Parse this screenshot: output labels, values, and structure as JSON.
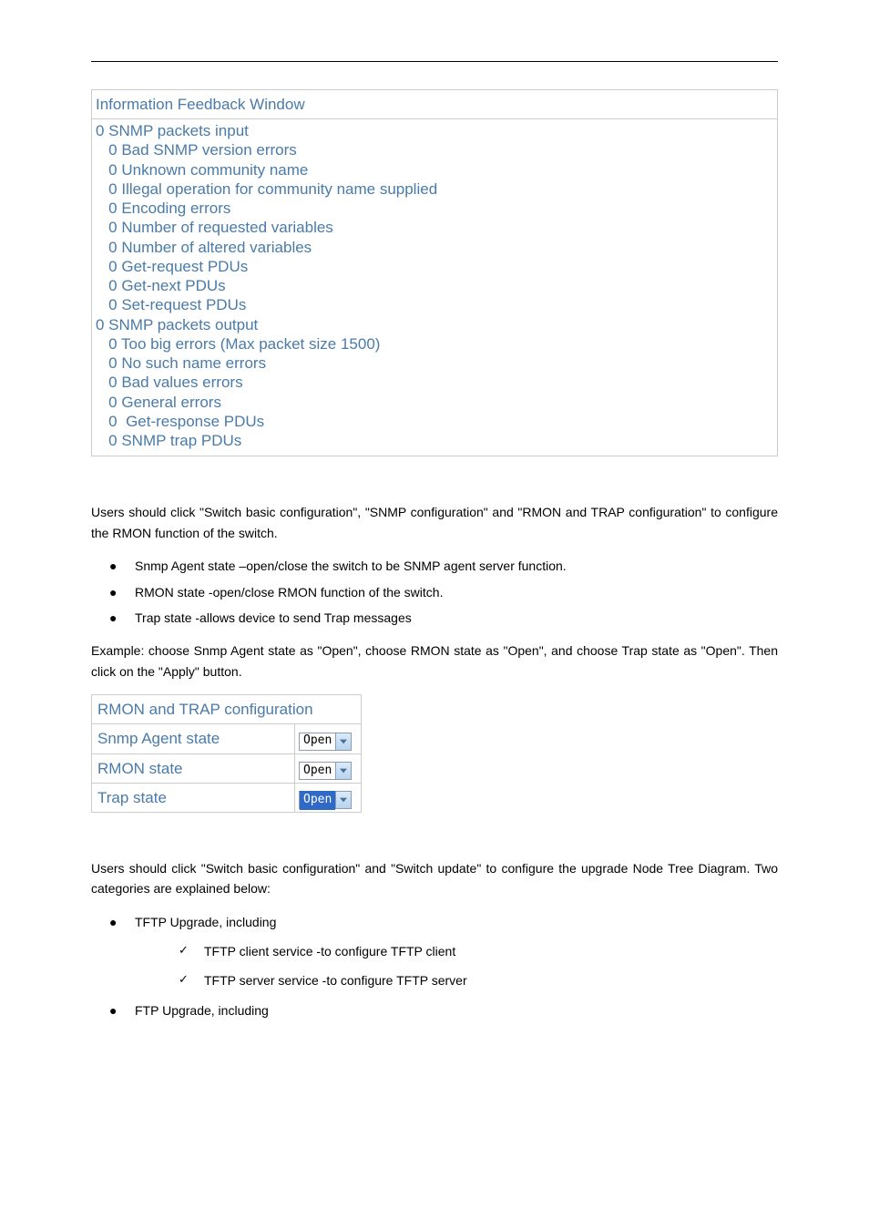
{
  "info_window": {
    "title": "Information Feedback Window",
    "lines": [
      "0 SNMP packets input",
      "   0 Bad SNMP version errors",
      "   0 Unknown community name",
      "   0 Illegal operation for community name supplied",
      "   0 Encoding errors",
      "   0 Number of requested variables",
      "   0 Number of altered variables",
      "   0 Get-request PDUs",
      "   0 Get-next PDUs",
      "   0 Set-request PDUs",
      "0 SNMP packets output",
      "   0 Too big errors (Max packet size 1500)",
      "   0 No such name errors",
      "   0 Bad values errors",
      "   0 General errors",
      "   0  Get-response PDUs",
      "   0 SNMP trap PDUs"
    ]
  },
  "paragraph1": "Users should click \"Switch basic configuration\", \"SNMP configuration\" and \"RMON and TRAP configuration\" to configure the RMON function of the switch.",
  "bullets1": [
    "Snmp Agent state –open/close the switch to be SNMP agent server function.",
    "RMON state -open/close RMON function of the switch.",
    "Trap state -allows device to send Trap messages"
  ],
  "paragraph2": "Example: choose Snmp Agent state as \"Open\", choose RMON state as \"Open\", and choose Trap state as \"Open\". Then click on the \"Apply\" button.",
  "cfg_table": {
    "title": "RMON and TRAP configuration",
    "rows": [
      {
        "label": "Snmp Agent state",
        "value": "Open",
        "highlight": false
      },
      {
        "label": "RMON state",
        "value": "Open",
        "highlight": false
      },
      {
        "label": "Trap state",
        "value": "Open",
        "highlight": true
      }
    ]
  },
  "paragraph3": "Users should click \"Switch basic configuration\" and \"Switch update\" to configure the upgrade Node Tree Diagram. Two categories are explained below:",
  "bullets2": [
    {
      "text": "TFTP Upgrade, including",
      "checks": [
        "TFTP client service -to configure TFTP client",
        "TFTP server service -to configure TFTP server"
      ]
    },
    {
      "text": "FTP Upgrade, including",
      "checks": []
    }
  ]
}
